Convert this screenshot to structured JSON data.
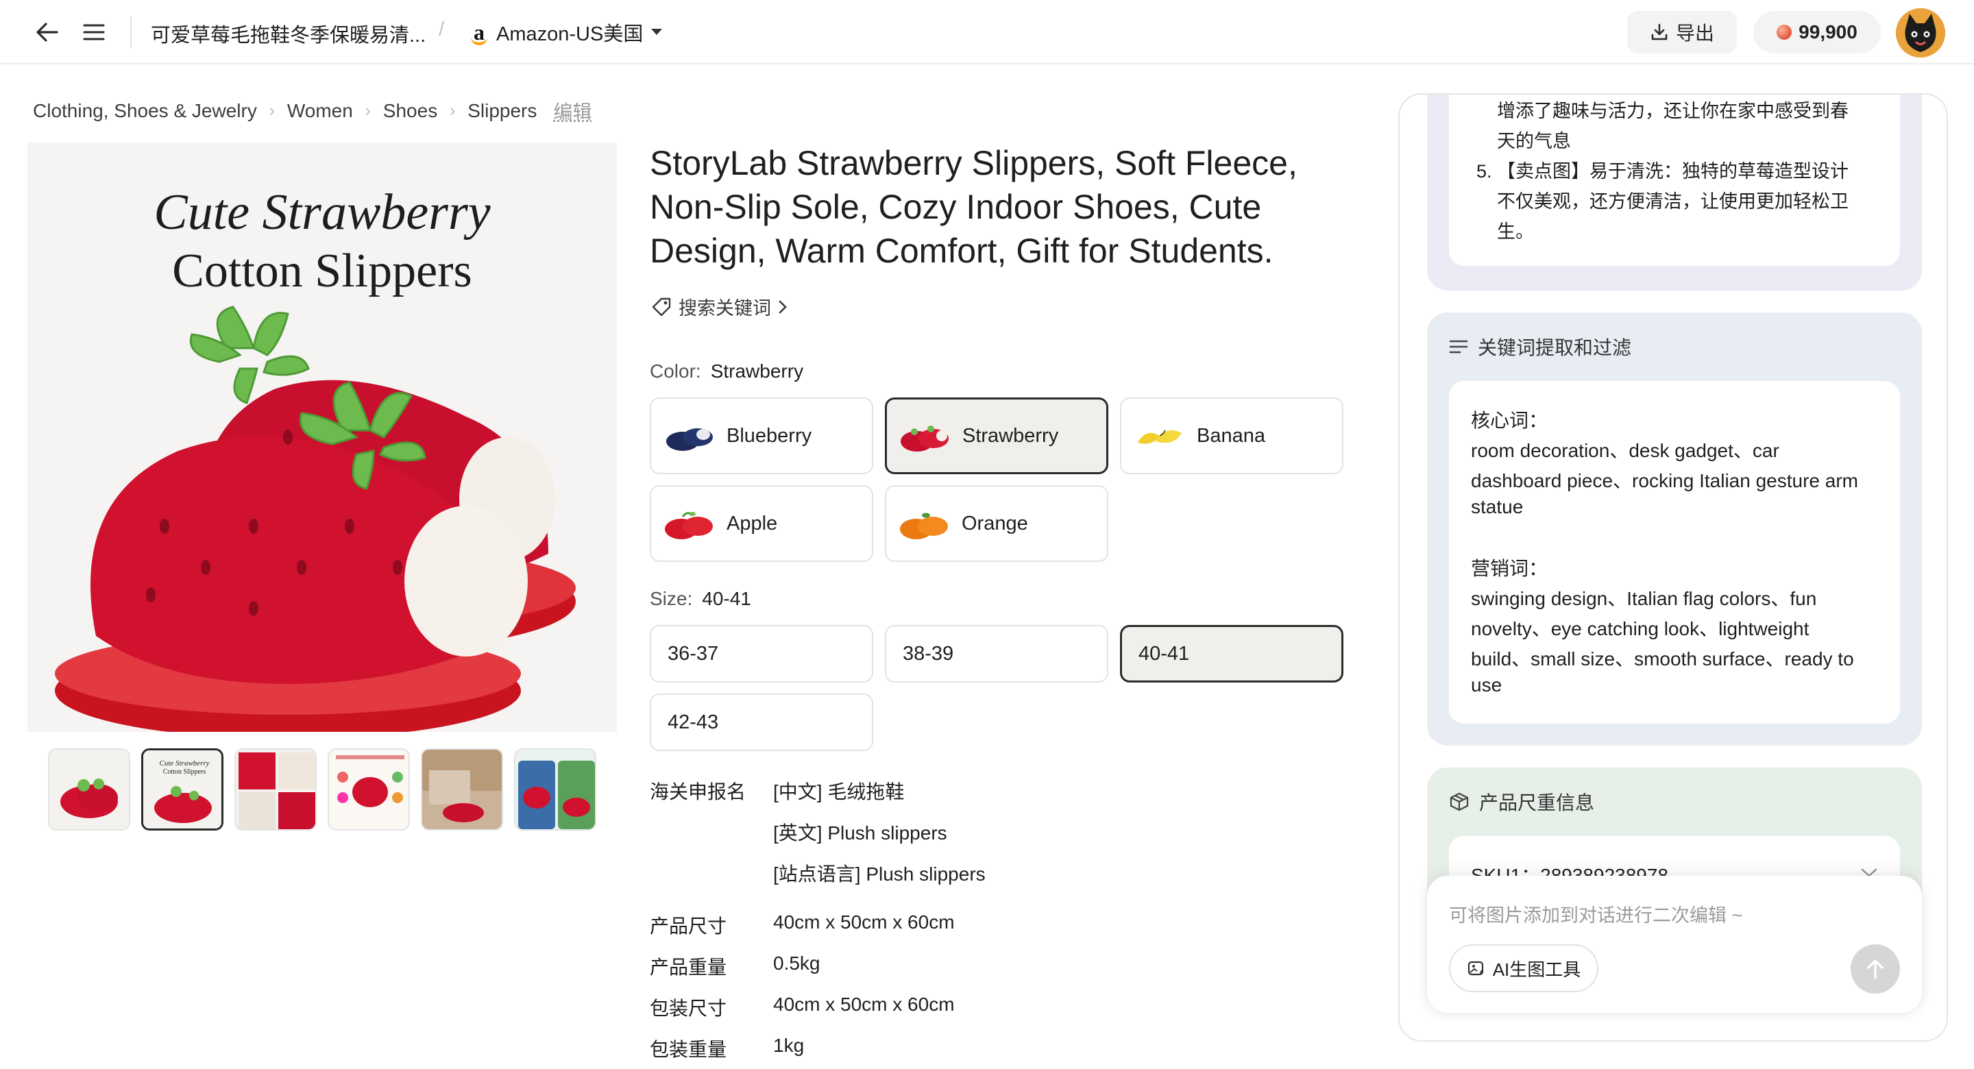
{
  "topbar": {
    "doc_title": "可爱草莓毛拖鞋冬季保暖易清...",
    "market": "Amazon-US美国",
    "export_label": "导出",
    "credits": "99,900"
  },
  "breadcrumb": {
    "items": [
      "Clothing, Shoes & Jewelry",
      "Women",
      "Shoes",
      "Slippers"
    ],
    "edit_label": "编辑"
  },
  "image": {
    "title_line1": "Cute Strawberry",
    "title_line2": "Cotton Slippers"
  },
  "product": {
    "title_lines": [
      "StoryLab Strawberry Slippers, Soft Fleece,",
      "Non-Slip Sole, Cozy Indoor Shoes, Cute",
      "Design, Warm Comfort, Gift for Students."
    ],
    "keyword_link": "搜索关键词",
    "color_label": "Color:",
    "color_selected": "Strawberry",
    "colors": [
      "Blueberry",
      "Strawberry",
      "Banana",
      "Apple",
      "Orange"
    ],
    "size_label": "Size:",
    "size_selected": "40-41",
    "sizes": [
      "36-37",
      "38-39",
      "40-41",
      "42-43"
    ],
    "customs_label": "海关申报名",
    "customs_values": [
      "[中文] 毛绒拖鞋",
      "[英文] Plush slippers",
      "[站点语言] Plush slippers"
    ],
    "specs": [
      {
        "key": "产品尺寸",
        "value": "40cm x 50cm x 60cm"
      },
      {
        "key": "产品重量",
        "value": "0.5kg"
      },
      {
        "key": "包装尺寸",
        "value": "40cm x 50cm x 60cm"
      },
      {
        "key": "包装重量",
        "value": "1kg"
      }
    ]
  },
  "panel": {
    "selling_lines": [
      "增添了趣味与活力，还让你在家中感受到春",
      "天的气息",
      "5.  【卖点图】易于清洗：独特的草莓造型设计",
      "不仅美观，还方便清洁，让使用更加轻松卫",
      "生。"
    ],
    "keywords_title": "关键词提取和过滤",
    "keywords_lines": [
      "核心词：",
      "room decoration、desk gadget、car",
      "dashboard piece、rocking Italian gesture arm",
      "statue",
      "营销词：",
      "swinging design、Italian flag colors、fun",
      "novelty、eye catching look、lightweight",
      "build、small size、smooth surface、ready to",
      "use"
    ],
    "size_weight_title": "产品尺重信息",
    "sku_line": "SKU1：289389238978",
    "chat_placeholder": "可将图片添加到对话进行二次编辑 ~",
    "ai_tool_label": "AI生图工具"
  }
}
